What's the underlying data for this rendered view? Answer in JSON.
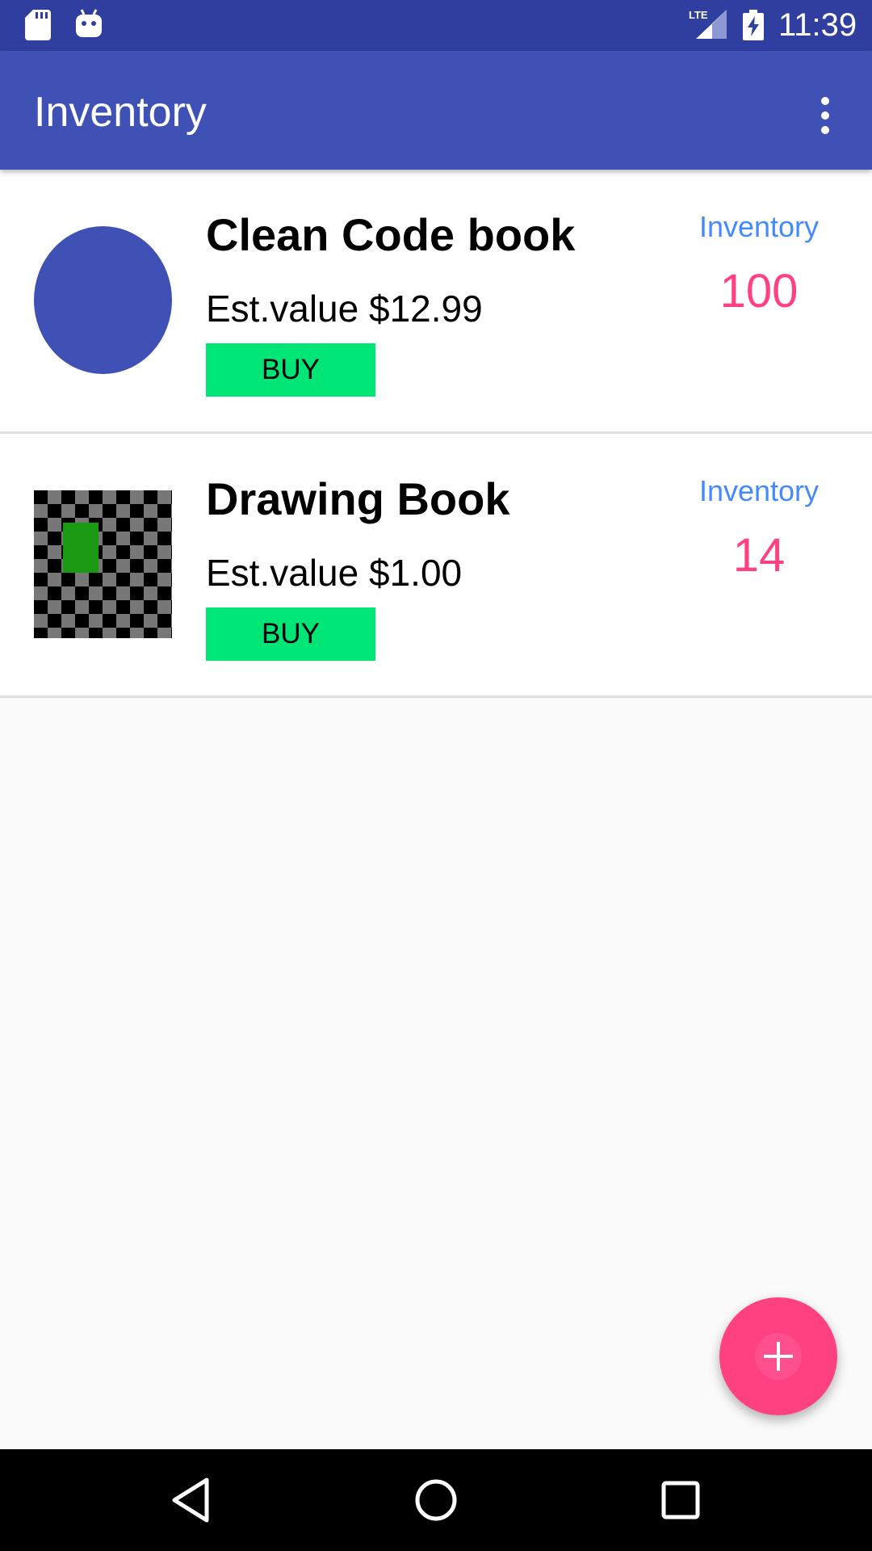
{
  "status_bar": {
    "time": "11:39",
    "network": "LTE"
  },
  "app_bar": {
    "title": "Inventory",
    "menu_icon": "more-vert-icon"
  },
  "items": [
    {
      "name": "Clean Code book",
      "price": "Est.value $12.99",
      "buy_label": "BUY",
      "inventory_label": "Inventory",
      "inventory_count": "100",
      "thumb": "circle"
    },
    {
      "name": "Drawing Book",
      "price": "Est.value $1.00",
      "buy_label": "BUY",
      "inventory_label": "Inventory",
      "inventory_count": "14",
      "thumb": "checker"
    }
  ],
  "fab": {
    "icon": "add-icon"
  },
  "nav_bar": {
    "icons": [
      "back-icon",
      "home-icon",
      "recents-icon"
    ]
  },
  "colors": {
    "primary_dark": "#303f9f",
    "primary": "#3f51b5",
    "accent": "#ff4081",
    "buy": "#00e676",
    "label": "#448aff"
  }
}
